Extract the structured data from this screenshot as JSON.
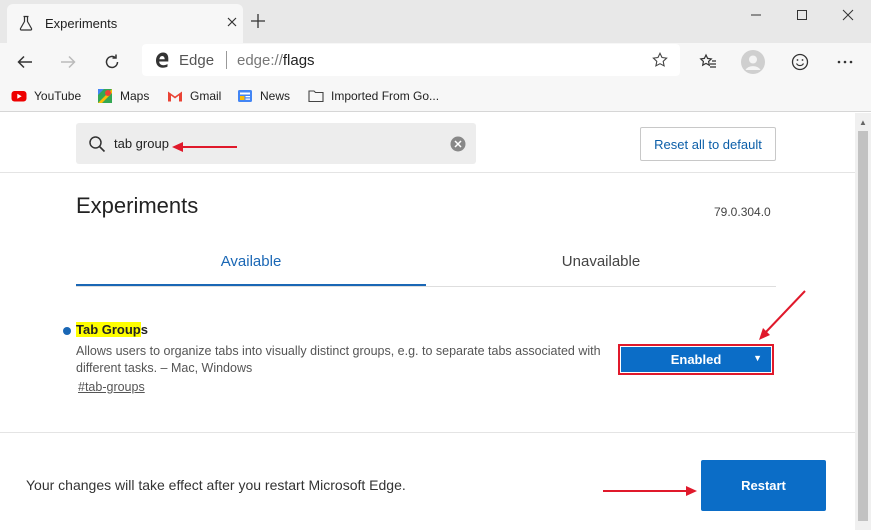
{
  "browser": {
    "tab_title": "Experiments",
    "omnibox_site": "Edge",
    "omnibox_url_prefix": "edge://",
    "omnibox_url_path": "flags"
  },
  "bookmarks": [
    {
      "label": "YouTube",
      "icon": "youtube-icon"
    },
    {
      "label": "Maps",
      "icon": "maps-icon"
    },
    {
      "label": "Gmail",
      "icon": "gmail-icon"
    },
    {
      "label": "News",
      "icon": "news-icon"
    },
    {
      "label": "Imported From Go...",
      "icon": "folder-icon"
    }
  ],
  "page": {
    "search_value": "tab group",
    "reset_label": "Reset all to default",
    "title": "Experiments",
    "version": "79.0.304.0",
    "tabs": [
      {
        "label": "Available",
        "active": true
      },
      {
        "label": "Unavailable",
        "active": false
      }
    ],
    "flag": {
      "title_highlight": "Tab Group",
      "title_rest": "s",
      "description": "Allows users to organize tabs into visually distinct groups, e.g. to separate tabs associated with different tasks. – Mac, Windows",
      "link": "#tab-groups",
      "selected": "Enabled"
    },
    "footer_message": "Your changes will take effect after you restart Microsoft Edge.",
    "restart_label": "Restart"
  },
  "colors": {
    "accent": "#0b6dc7",
    "annotation": "#e0192b",
    "highlight": "#ffff00"
  }
}
